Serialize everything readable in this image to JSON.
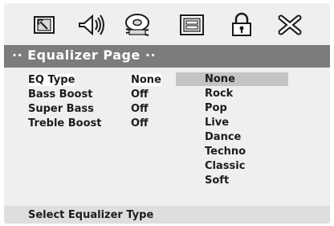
{
  "tabs": [
    {
      "icon": "general-setup-icon"
    },
    {
      "icon": "speaker-setup-icon"
    },
    {
      "icon": "video-setup-icon"
    },
    {
      "icon": "preference-icon"
    },
    {
      "icon": "password-lock-icon"
    },
    {
      "icon": "exit-icon"
    }
  ],
  "header": {
    "title": "·· Equalizer Page ··"
  },
  "settings": [
    {
      "label": "EQ Type",
      "value": "None",
      "selected": true
    },
    {
      "label": "Bass Boost",
      "value": "Off",
      "selected": false
    },
    {
      "label": "Super Bass",
      "value": "Off",
      "selected": false
    },
    {
      "label": "Treble Boost",
      "value": "Off",
      "selected": false
    }
  ],
  "options": {
    "items": [
      "None",
      "Rock",
      "Pop",
      "Live",
      "Dance",
      "Techno",
      "Classic",
      "Soft"
    ],
    "highlighted": "None"
  },
  "status": {
    "text": "Select Equalizer Type"
  },
  "colors": {
    "header_bar": "#7c7c7c",
    "panel_bg": "#efefef",
    "highlight": "#c4c4c4",
    "status_bar": "#dedede",
    "text": "#1c1c1c"
  }
}
